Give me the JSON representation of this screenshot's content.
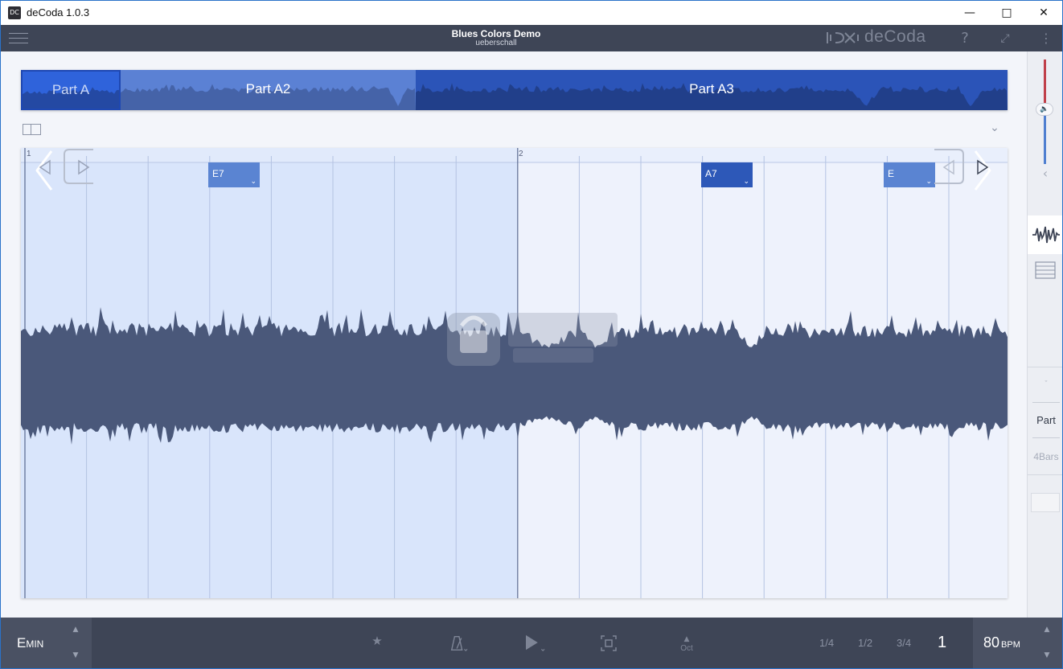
{
  "window": {
    "title": "deCoda 1.0.3",
    "minimize_icon": "minimize-icon",
    "maximize_icon": "maximize-icon",
    "close_icon": "close-icon"
  },
  "header": {
    "song_title": "Blues Colors Demo",
    "artist": "ueberschall",
    "brand": "deCoda",
    "help_label": "?",
    "menu_icon": "hamburger-menu-icon"
  },
  "parts": [
    {
      "label": "Part A",
      "selected": true
    },
    {
      "label": "Part A2",
      "selected": false
    },
    {
      "label": "Part A3",
      "selected": false
    }
  ],
  "timeline": {
    "bars": [
      {
        "label": "1"
      },
      {
        "label": "2"
      }
    ],
    "chords": [
      {
        "label": "E7",
        "color": "#5a84d2"
      },
      {
        "label": "A7",
        "color": "#2d58b8"
      },
      {
        "label": "E",
        "color": "#5a84d2"
      }
    ],
    "chord_dropdown_glyph": "⌄"
  },
  "sidebar": {
    "part_label": "Part",
    "bars_label": "4Bars",
    "volume_icon": "speaker-icon",
    "collapse_icon": "chevron-left-icon",
    "waveform_tab_icon": "waveform-icon",
    "list_tab_icon": "list-icon"
  },
  "transport": {
    "key_main": "E",
    "key_mode": "MIN",
    "octave_label": "Oct",
    "speeds": [
      "1/4",
      "1/2",
      "3/4"
    ],
    "speed_current": "1",
    "bpm_value": "80",
    "bpm_unit": "BPM"
  },
  "colors": {
    "header_bg": "#3e4556",
    "accent_blue": "#2b54b8",
    "wave_fill": "#4a587a",
    "selection_bg": "#d9e5fb"
  }
}
